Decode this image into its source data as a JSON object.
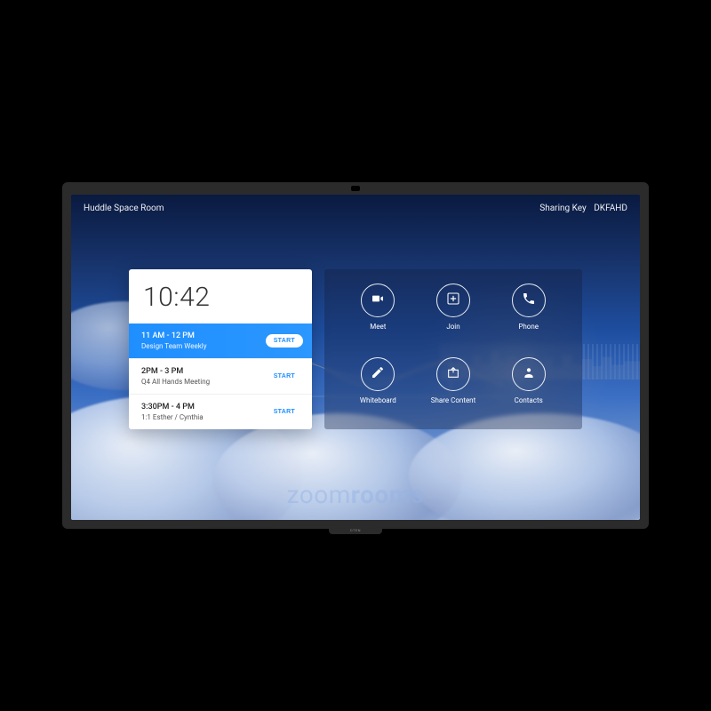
{
  "header": {
    "room_name": "Huddle Space Room",
    "sharing_label": "Sharing Key",
    "sharing_key": "DKFAHD"
  },
  "clock": "10:42",
  "events": [
    {
      "time": "11 AM - 12 PM",
      "title": "Design Team Weekly",
      "button": "START",
      "active": true
    },
    {
      "time": "2PM - 3 PM",
      "title": "Q4 All Hands Meeting",
      "button": "START",
      "active": false
    },
    {
      "time": "3:30PM - 4 PM",
      "title": "1:1 Esther / Cynthia",
      "button": "START",
      "active": false
    }
  ],
  "actions": [
    {
      "id": "meet",
      "label": "Meet",
      "icon": "video-icon"
    },
    {
      "id": "join",
      "label": "Join",
      "icon": "plus-icon"
    },
    {
      "id": "phone",
      "label": "Phone",
      "icon": "phone-icon"
    },
    {
      "id": "whiteboard",
      "label": "Whiteboard",
      "icon": "pen-icon"
    },
    {
      "id": "sharecontent",
      "label": "Share Content",
      "icon": "share-icon"
    },
    {
      "id": "contacts",
      "label": "Contacts",
      "icon": "person-icon"
    }
  ],
  "watermark": {
    "brand": "zoom",
    "suffix": "rooms"
  },
  "device_brand": "DTEN"
}
